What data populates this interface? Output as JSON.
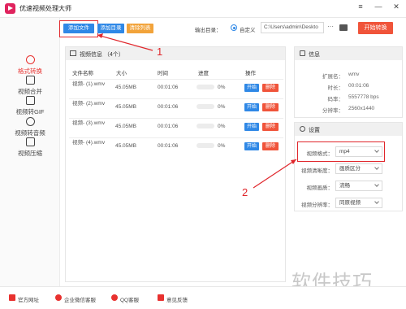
{
  "app": {
    "title": "优速视频处理大师"
  },
  "window_buttons": [
    "≡",
    "—",
    "✕"
  ],
  "sidebar": {
    "items": [
      {
        "label": "格式转换",
        "icon": "refresh-icon"
      },
      {
        "label": "视频合并",
        "icon": "merge-icon"
      },
      {
        "label": "视频转GIF",
        "icon": "gif-icon"
      },
      {
        "label": "视频转音频",
        "icon": "audio-icon"
      },
      {
        "label": "视频压缩",
        "icon": "compress-icon"
      }
    ]
  },
  "toolbar": {
    "add_file": "添加文件",
    "add_folder": "添加目录",
    "clear_list": "清除列表",
    "output_label": "输出目录：",
    "custom_option": "自定义",
    "output_path": "C:\\Users\\admin\\Deskto",
    "more": "···",
    "start_convert": "开始转换"
  },
  "video_panel": {
    "title": "视频信息 （4个）",
    "columns": [
      "文件名称",
      "大小",
      "时间",
      "进度",
      "操作"
    ],
    "rows": [
      {
        "name": "视频- (1).wmv",
        "size": "45.05MB",
        "duration": "00:01:06",
        "progress": "0%",
        "progress_value": 0,
        "start": "开始",
        "delete": "删除"
      },
      {
        "name": "视频- (2).wmv",
        "size": "45.05MB",
        "duration": "00:01:06",
        "progress": "0%",
        "progress_value": 0,
        "start": "开始",
        "delete": "删除"
      },
      {
        "name": "视频- (3).wmv",
        "size": "45.05MB",
        "duration": "00:01:06",
        "progress": "0%",
        "progress_value": 0,
        "start": "开始",
        "delete": "删除"
      },
      {
        "name": "视频- (4).wmv",
        "size": "45.05MB",
        "duration": "00:01:06",
        "progress": "0%",
        "progress_value": 0,
        "start": "开始",
        "delete": "删除"
      }
    ]
  },
  "info_panel": {
    "title": "信息",
    "fields": [
      {
        "key": "扩展名：",
        "value": "wmv"
      },
      {
        "key": "时长：",
        "value": "00:01:06"
      },
      {
        "key": "码率：",
        "value": "5557778 bps"
      },
      {
        "key": "分辨率：",
        "value": "2560x1440"
      }
    ]
  },
  "settings_panel": {
    "title": "设置",
    "fields": [
      {
        "key": "视频格式：",
        "value": "mp4"
      },
      {
        "key": "视频清晰度：",
        "value": "画质区分"
      },
      {
        "key": "视频画质：",
        "value": "流畅"
      },
      {
        "key": "视频分辨率：",
        "value": "同原视频"
      }
    ]
  },
  "annotations": {
    "marker1": "1",
    "marker2": "2"
  },
  "watermark": "软件技巧",
  "footer": {
    "items": [
      {
        "label": "官方网址",
        "icon": "home-icon"
      },
      {
        "label": "企业微信客服",
        "icon": "wechat-icon"
      },
      {
        "label": "QQ客服",
        "icon": "qq-icon"
      },
      {
        "label": "意见反馈",
        "icon": "feedback-icon"
      }
    ]
  },
  "colors": {
    "accent": "#e8312f",
    "primary": "#2f88e6",
    "highlight": "#e0262b",
    "clear": "#f2a33a"
  }
}
